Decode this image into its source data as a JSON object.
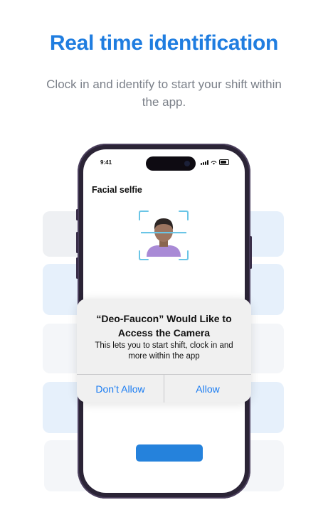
{
  "header": {
    "title": "Real time identification",
    "subtitle": "Clock in and identify to start your shift within the app."
  },
  "phone": {
    "status_time": "9:41",
    "screen_title": "Facial selfie",
    "primary_button_label": ""
  },
  "alert": {
    "title": "“Deo-Faucon” Would Like to Access the Camera",
    "message": "This lets you to start shift, clock in and more within the app",
    "deny_label": "Don’t Allow",
    "allow_label": "Allow"
  },
  "colors": {
    "accent": "#1f7de0",
    "button": "#2582dc",
    "alert_button_text": "#1a7cf2",
    "scan_frame": "#6ac5e6"
  },
  "icons": {
    "face_scan": "face-id-scan-icon",
    "signal": "cellular-signal-icon",
    "wifi": "wifi-icon",
    "battery": "battery-icon"
  }
}
